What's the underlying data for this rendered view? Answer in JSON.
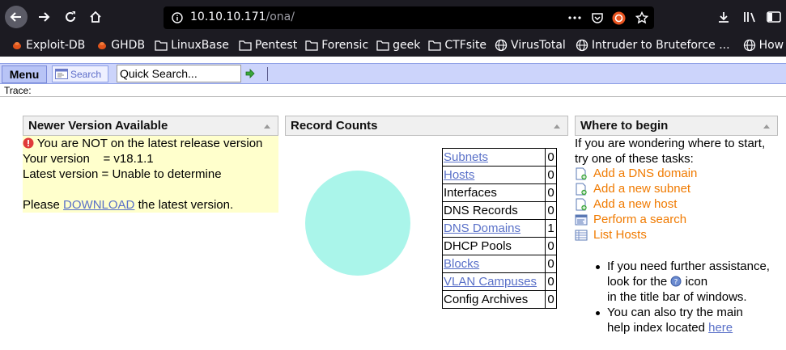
{
  "browser": {
    "url_host": "10.10.10.171",
    "url_path": "/ona/",
    "bookmarks": [
      {
        "label": "Exploit-DB",
        "icon": "bug-icon"
      },
      {
        "label": "GHDB",
        "icon": "bug-icon"
      },
      {
        "label": "LinuxBase",
        "icon": "folder-icon"
      },
      {
        "label": "Pentest",
        "icon": "folder-icon"
      },
      {
        "label": "Forensic",
        "icon": "folder-icon"
      },
      {
        "label": "geek",
        "icon": "folder-icon"
      },
      {
        "label": "CTFsite",
        "icon": "folder-icon"
      },
      {
        "label": "VirusTotal",
        "icon": "globe-icon"
      },
      {
        "label": "Intruder to Bruteforce ...",
        "icon": "globe-icon"
      },
      {
        "label": "How H",
        "icon": "globe-icon"
      }
    ]
  },
  "menubar": {
    "menu_label": "Menu",
    "search_label": "Search",
    "quick_search_value": "Quick Search..."
  },
  "trace_label": "Trace:",
  "version_box": {
    "title": "Newer Version Available",
    "warning": "You are NOT on the latest release version",
    "your_version": "Your version    = v18.1.1",
    "latest_version": "Latest version = Unable to determine",
    "please": "Please",
    "download": "DOWNLOAD",
    "after": "the latest version."
  },
  "record_counts": {
    "title": "Record Counts",
    "rows": [
      {
        "name": "Subnets",
        "count": "0",
        "link": true
      },
      {
        "name": "Hosts",
        "count": "0",
        "link": true
      },
      {
        "name": "Interfaces",
        "count": "0",
        "link": false
      },
      {
        "name": "DNS Records",
        "count": "0",
        "link": false
      },
      {
        "name": "DNS Domains",
        "count": "1",
        "link": true
      },
      {
        "name": "DHCP Pools",
        "count": "0",
        "link": false
      },
      {
        "name": "Blocks",
        "count": "0",
        "link": true
      },
      {
        "name": "VLAN Campuses",
        "count": "0",
        "link": true
      },
      {
        "name": "Config Archives",
        "count": "0",
        "link": false
      }
    ],
    "pie_color": "#aaf5ea"
  },
  "where_box": {
    "title": "Where to begin",
    "intro1": "If you are wondering where to start,",
    "intro2": "try one of these tasks:",
    "tasks": [
      {
        "label": "Add a DNS domain",
        "icon": "add-page-icon"
      },
      {
        "label": "Add a new subnet",
        "icon": "add-page-icon"
      },
      {
        "label": "Add a new host",
        "icon": "add-page-icon"
      },
      {
        "label": "Perform a search",
        "icon": "search-list-icon"
      },
      {
        "label": "List Hosts",
        "icon": "list-icon"
      }
    ],
    "bullet1_a": "If you need further assistance,",
    "bullet1_b": "look for the",
    "bullet1_c": "icon",
    "bullet1_d": "in the title bar of windows.",
    "bullet2_a": "You can also try the main",
    "bullet2_b": "help index located",
    "bullet2_link": "here"
  },
  "colors": {
    "task_link": "#f07a00",
    "page_link": "#5970c8",
    "menubar_bg": "#ccd4fb",
    "version_bg": "#ffffcc"
  }
}
